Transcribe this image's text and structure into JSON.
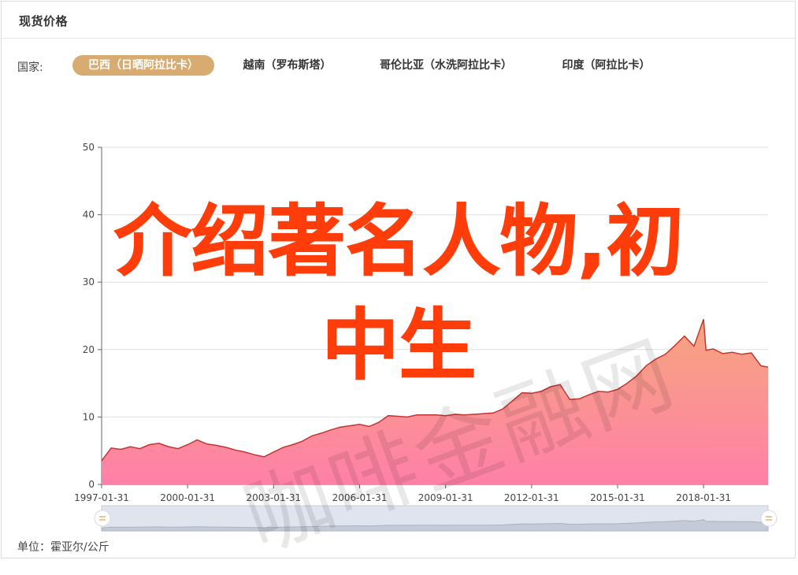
{
  "panel": {
    "title": "现货价格",
    "filter_label": "国家:",
    "unit_label": "单位：霍亚尔/公斤"
  },
  "tabs": [
    {
      "label": "巴西（日晒阿拉比卡）",
      "active": true
    },
    {
      "label": "越南（罗布斯塔）",
      "active": false
    },
    {
      "label": "哥伦比亚（水洗阿拉比卡）",
      "active": false
    },
    {
      "label": "印度（阿拉比卡）",
      "active": false
    }
  ],
  "overlay": {
    "headline_line1": "介绍著名人物,初",
    "headline_line2": "中生",
    "watermark": "咖啡金融网"
  },
  "colors": {
    "accent": "#d8ab71",
    "line": "#c23531",
    "area_top": "#f6a57e",
    "area_bottom": "#ff80a8",
    "headline": "#ff3d0a"
  },
  "chart_data": {
    "type": "area",
    "title": "",
    "xlabel": "",
    "ylabel": "",
    "ylim": [
      0,
      50
    ],
    "y_ticks": [
      "0",
      "10",
      "20",
      "30",
      "40",
      "50"
    ],
    "x_ticks": [
      "1997-01-31",
      "2000-01-31",
      "2003-01-31",
      "2006-01-31",
      "2009-01-31",
      "2012-01-31",
      "2015-01-31",
      "2018-01-31"
    ],
    "grid": true,
    "data_zoom": true,
    "series": [
      {
        "points": [
          [
            "1997-01",
            3.5
          ],
          [
            "1997-05",
            5.4
          ],
          [
            "1997-09",
            5.2
          ],
          [
            "1998-01",
            5.6
          ],
          [
            "1998-05",
            5.3
          ],
          [
            "1998-09",
            5.9
          ],
          [
            "1999-01",
            6.1
          ],
          [
            "1999-05",
            5.6
          ],
          [
            "1999-09",
            5.3
          ],
          [
            "2000-01",
            5.9
          ],
          [
            "2000-05",
            6.6
          ],
          [
            "2000-09",
            6.0
          ],
          [
            "2001-01",
            5.8
          ],
          [
            "2001-05",
            5.5
          ],
          [
            "2001-09",
            5.1
          ],
          [
            "2002-01",
            4.8
          ],
          [
            "2002-05",
            4.4
          ],
          [
            "2002-09",
            4.1
          ],
          [
            "2003-01",
            4.8
          ],
          [
            "2003-05",
            5.5
          ],
          [
            "2003-09",
            5.9
          ],
          [
            "2004-01",
            6.4
          ],
          [
            "2004-05",
            7.2
          ],
          [
            "2004-09",
            7.6
          ],
          [
            "2005-01",
            8.1
          ],
          [
            "2005-05",
            8.5
          ],
          [
            "2005-09",
            8.7
          ],
          [
            "2006-01",
            8.9
          ],
          [
            "2006-05",
            8.6
          ],
          [
            "2006-09",
            9.2
          ],
          [
            "2007-01",
            10.2
          ],
          [
            "2007-05",
            10.1
          ],
          [
            "2007-09",
            10.0
          ],
          [
            "2008-01",
            10.3
          ],
          [
            "2008-05",
            10.3
          ],
          [
            "2008-09",
            10.3
          ],
          [
            "2009-01",
            10.2
          ],
          [
            "2009-05",
            10.4
          ],
          [
            "2009-09",
            10.3
          ],
          [
            "2010-01",
            10.4
          ],
          [
            "2010-05",
            10.5
          ],
          [
            "2010-09",
            10.6
          ],
          [
            "2011-01",
            11.2
          ],
          [
            "2011-05",
            12.4
          ],
          [
            "2011-09",
            13.6
          ],
          [
            "2012-01",
            13.5
          ],
          [
            "2012-05",
            13.8
          ],
          [
            "2012-09",
            14.5
          ],
          [
            "2013-01",
            14.8
          ],
          [
            "2013-05",
            12.6
          ],
          [
            "2013-09",
            12.7
          ],
          [
            "2014-01",
            13.3
          ],
          [
            "2014-05",
            13.8
          ],
          [
            "2014-09",
            13.7
          ],
          [
            "2015-01",
            14.1
          ],
          [
            "2015-05",
            15.0
          ],
          [
            "2015-09",
            16.1
          ],
          [
            "2016-01",
            17.6
          ],
          [
            "2016-05",
            18.6
          ],
          [
            "2016-09",
            19.3
          ],
          [
            "2017-01",
            20.6
          ],
          [
            "2017-05",
            22.0
          ],
          [
            "2017-09",
            20.5
          ],
          [
            "2018-01",
            24.5
          ],
          [
            "2018-02",
            19.9
          ],
          [
            "2018-05",
            20.1
          ],
          [
            "2018-09",
            19.4
          ],
          [
            "2019-01",
            19.6
          ],
          [
            "2019-05",
            19.3
          ],
          [
            "2019-09",
            19.5
          ],
          [
            "2020-01",
            17.6
          ],
          [
            "2020-04",
            17.4
          ]
        ]
      }
    ]
  }
}
